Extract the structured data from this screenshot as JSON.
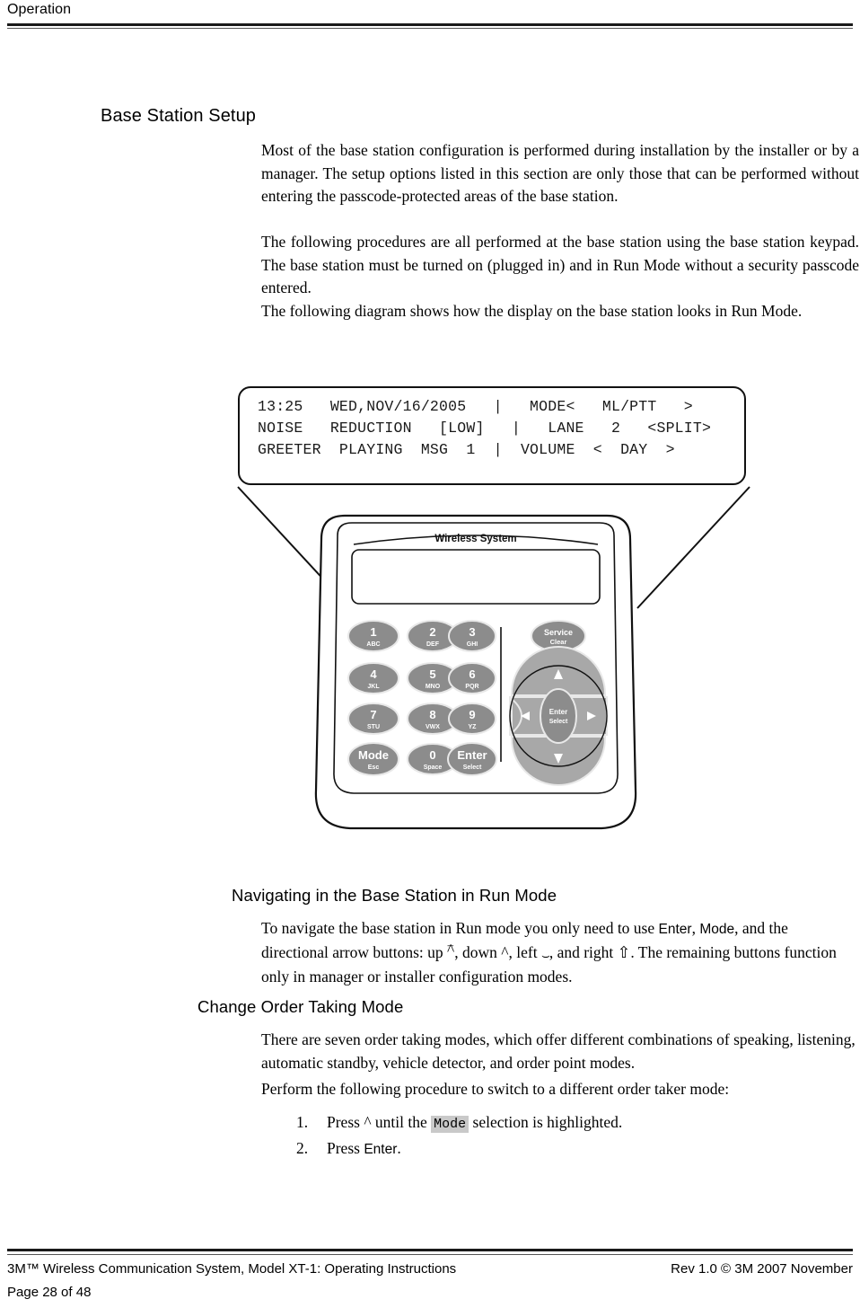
{
  "header": {
    "running_head": "Operation"
  },
  "sections": {
    "base_station_setup": {
      "heading": "Base Station Setup",
      "paragraphs": [
        "Most of the base station configuration is performed during installation by the installer or by a manager.  The setup options listed in this section are only those that can be performed without entering the passcode-protected areas of the base station.",
        "The following procedures are all performed at the base station using the base station keypad.  The base station must be turned on (plugged in) and in Run Mode without a security passcode entered.",
        "The following diagram shows how the display on the base station looks in Run Mode."
      ]
    },
    "navigating": {
      "heading": "Navigating in the Base Station in Run Mode",
      "text_part_1": "To navigate the base station in Run mode you only need to use ",
      "key_enter": "Enter",
      "text_comma_1": ", ",
      "key_mode": "Mode",
      "text_part_2": ", and the directional arrow buttons: up ",
      "arrow_up": "^",
      "text_part_3": ", down ",
      "arrow_down": "^",
      "text_part_4": ", left ",
      "arrow_left": "⌣",
      "text_part_5": ", and right ",
      "arrow_right": "⇧",
      "text_part_6": ".  The remaining buttons function only in manager or installer configuration modes."
    },
    "change_order_taking_mode": {
      "heading": "Change Order Taking Mode",
      "paragraphs": [
        "There are seven order taking modes, which offer different combinations of speaking, listening, automatic standby, vehicle detector, and order point modes.",
        "Perform the following procedure to switch to a different order taker mode:"
      ],
      "steps": [
        {
          "number": "1.",
          "text_before": "Press ",
          "arrow": "^",
          "text_middle": " until the ",
          "chip": "Mode",
          "text_after": " selection is highlighted."
        },
        {
          "number": "2.",
          "text_before": "Press ",
          "key": "Enter",
          "text_after": "."
        }
      ]
    }
  },
  "lcd_display": {
    "line_1": "13:25   WED,NOV/16/2005   |   MODE<   ML/PTT   >",
    "line_2": "NOISE   REDUCTION   [LOW]   |   LANE   2   <SPLIT>",
    "line_3": "GREETER  PLAYING  MSG  1  |  VOLUME  <  DAY  >"
  },
  "device": {
    "brand_label": "Wireless System",
    "keypad": [
      {
        "digit": "1",
        "letters": "ABC"
      },
      {
        "digit": "2",
        "letters": "DEF"
      },
      {
        "digit": "3",
        "letters": "GHI"
      },
      {
        "digit": "4",
        "letters": "JKL"
      },
      {
        "digit": "5",
        "letters": "MNO"
      },
      {
        "digit": "6",
        "letters": "PQR"
      },
      {
        "digit": "7",
        "letters": "STU"
      },
      {
        "digit": "8",
        "letters": "VWX"
      },
      {
        "digit": "9",
        "letters": "YZ"
      },
      {
        "digit": "Mode",
        "letters": "Esc"
      },
      {
        "digit": "0",
        "letters": "Space"
      },
      {
        "digit": "Enter",
        "letters": "Select"
      }
    ],
    "service_button": {
      "label": "Service",
      "sublabel": "Clear"
    },
    "nav_center": {
      "label": "Enter",
      "sublabel": "Select"
    },
    "nav_arrows": {
      "up": "▲",
      "down": "▼",
      "left": "◀",
      "right": "▶"
    }
  },
  "footer": {
    "left": "3M™ Wireless Communication System, Model XT-1: Operating Instructions",
    "right": "Rev 1.0 © 3M 2007 November",
    "page": "Page 28 of 48"
  },
  "colors": {
    "ink": "#000000",
    "rule": "#1a1a1a",
    "chip_bg": "#c9c9c9",
    "key_fill": "#8c8c8c",
    "nav_fill": "#a8a8a8"
  }
}
